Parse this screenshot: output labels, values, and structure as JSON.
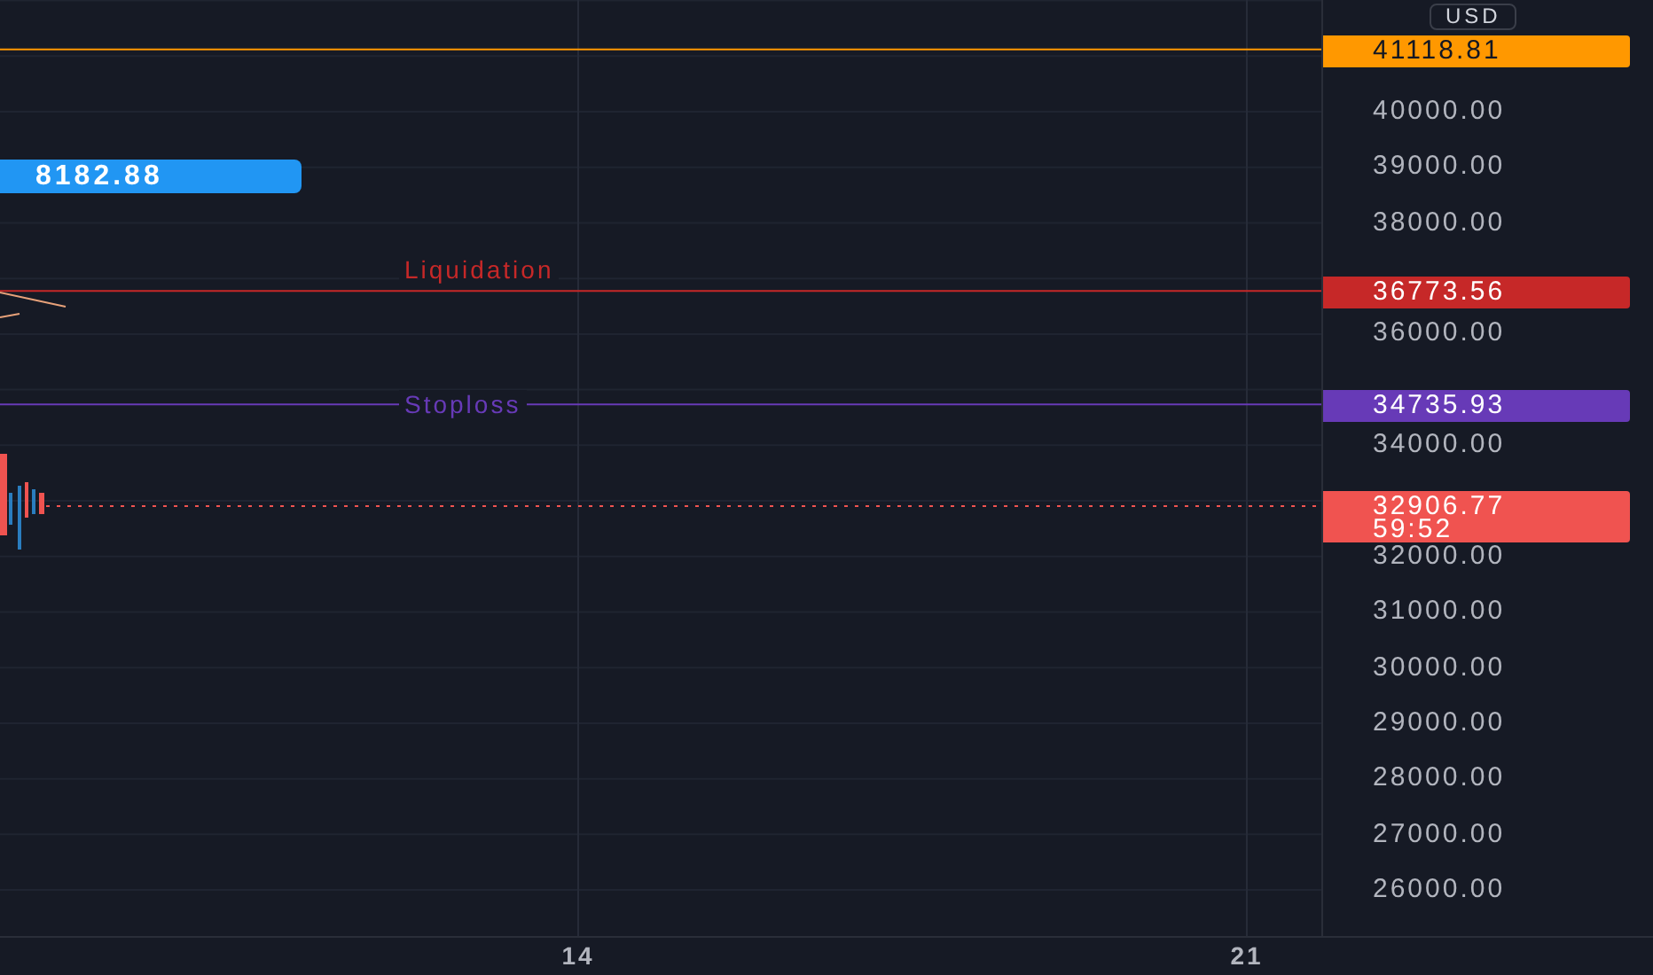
{
  "price_axis": {
    "currency": "USD",
    "ticks": [
      "40000.00",
      "39000.00",
      "38000.00",
      "36000.00",
      "34000.00",
      "32000.00",
      "31000.00",
      "30000.00",
      "29000.00",
      "28000.00",
      "27000.00",
      "26000.00"
    ]
  },
  "time_axis": {
    "ticks": [
      "14",
      "21"
    ]
  },
  "marker": {
    "price": "8182.88",
    "color": "#2196f3"
  },
  "price_lines": [
    {
      "price": "41118.81",
      "color": "#ff9800"
    },
    {
      "label": "Liquidation",
      "price": "36773.56",
      "color": "#c62828"
    },
    {
      "label": "Stoploss",
      "price": "34735.93",
      "color": "#673ab7"
    }
  ],
  "current_price": {
    "price": "32906.77",
    "countdown": "59:52",
    "color": "#f05350"
  }
}
